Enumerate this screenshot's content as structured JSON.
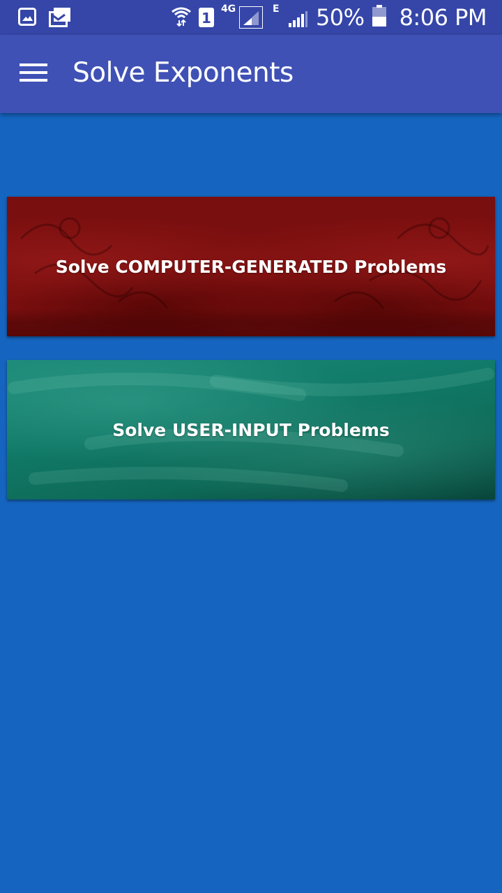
{
  "status_bar": {
    "network_type": "4G",
    "secondary_network": "E",
    "sim_slot": "1",
    "battery_percent": "50%",
    "time": "8:06 PM",
    "icons": [
      "gallery-icon",
      "gmail-icon",
      "wifi-icon",
      "sim-1-icon",
      "signal-4g-icon",
      "signal-e-icon",
      "battery-icon"
    ]
  },
  "app_bar": {
    "title": "Solve Exponents"
  },
  "main": {
    "cards": [
      {
        "label": "Solve COMPUTER-GENERATED Problems",
        "color": "#7a0e0e"
      },
      {
        "label": "Solve USER-INPUT Problems",
        "color": "#117a68"
      }
    ]
  },
  "colors": {
    "status_bar": "#3546a8",
    "app_bar": "#3f51b5",
    "background": "#1565c0"
  }
}
